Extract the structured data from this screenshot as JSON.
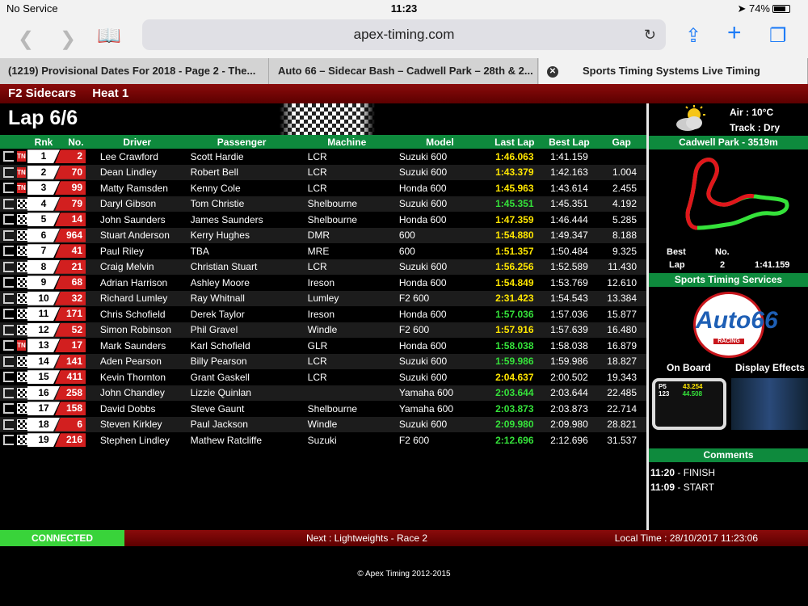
{
  "status": {
    "carrier": "No Service",
    "time": "11:23",
    "battery": "74%"
  },
  "browser": {
    "url": "apex-timing.com",
    "tabs": [
      "(1219) Provisional Dates For 2018 - Page 2 - The...",
      "Auto 66 – Sidecar Bash – Cadwell Park – 28th & 2...",
      "Sports Timing Systems Live Timing"
    ]
  },
  "event": {
    "class": "F2 Sidecars",
    "session": "Heat 1",
    "lap": "Lap 6/6"
  },
  "table": {
    "headers": [
      "Rnk",
      "No.",
      "Driver",
      "Passenger",
      "Machine",
      "Model",
      "Last Lap",
      "Best Lap",
      "Gap"
    ],
    "rows": [
      [
        "tn",
        "1",
        "2",
        "Lee Crawford",
        "Scott Hardie",
        "LCR",
        "Suzuki 600",
        "1:46.063",
        "y",
        "1:41.159",
        ""
      ],
      [
        "tn",
        "2",
        "70",
        "Dean Lindley",
        "Robert Bell",
        "LCR",
        "Suzuki 600",
        "1:43.379",
        "y",
        "1:42.163",
        "1.004"
      ],
      [
        "tn",
        "3",
        "99",
        "Matty Ramsden",
        "Kenny Cole",
        "LCR",
        "Honda 600",
        "1:45.963",
        "y",
        "1:43.614",
        "2.455"
      ],
      [
        "flag",
        "4",
        "79",
        "Daryl Gibson",
        "Tom Christie",
        "Shelbourne",
        "Suzuki 600",
        "1:45.351",
        "g",
        "1:45.351",
        "4.192"
      ],
      [
        "flag",
        "5",
        "14",
        "John Saunders",
        "James Saunders",
        "Shelbourne",
        "Honda 600",
        "1:47.359",
        "y",
        "1:46.444",
        "5.285"
      ],
      [
        "flag",
        "6",
        "964",
        "Stuart Anderson",
        "Kerry Hughes",
        "DMR",
        "600",
        "1:54.880",
        "y",
        "1:49.347",
        "8.188"
      ],
      [
        "flag",
        "7",
        "41",
        "Paul Riley",
        "TBA",
        "MRE",
        "600",
        "1:51.357",
        "y",
        "1:50.484",
        "9.325"
      ],
      [
        "flag",
        "8",
        "21",
        "Craig Melvin",
        "Christian Stuart",
        "LCR",
        "Suzuki 600",
        "1:56.256",
        "y",
        "1:52.589",
        "11.430"
      ],
      [
        "flag",
        "9",
        "68",
        "Adrian Harrison",
        "Ashley Moore",
        "Ireson",
        "Honda 600",
        "1:54.849",
        "y",
        "1:53.769",
        "12.610"
      ],
      [
        "flag",
        "10",
        "32",
        "Richard Lumley",
        "Ray Whitnall",
        "Lumley",
        "F2 600",
        "2:31.423",
        "y",
        "1:54.543",
        "13.384"
      ],
      [
        "flag",
        "11",
        "171",
        "Chris Schofield",
        "Derek Taylor",
        "Ireson",
        "Honda 600",
        "1:57.036",
        "g",
        "1:57.036",
        "15.877"
      ],
      [
        "flag",
        "12",
        "52",
        "Simon Robinson",
        "Phil Gravel",
        "Windle",
        "F2 600",
        "1:57.916",
        "y",
        "1:57.639",
        "16.480"
      ],
      [
        "tn",
        "13",
        "17",
        "Mark Saunders",
        "Karl Schofield",
        "GLR",
        "Honda 600",
        "1:58.038",
        "g",
        "1:58.038",
        "16.879"
      ],
      [
        "flag",
        "14",
        "141",
        "Aden Pearson",
        "Billy Pearson",
        "LCR",
        "Suzuki 600",
        "1:59.986",
        "g",
        "1:59.986",
        "18.827"
      ],
      [
        "flag",
        "15",
        "411",
        "Kevin Thornton",
        "Grant Gaskell",
        "LCR",
        "Suzuki 600",
        "2:04.637",
        "y",
        "2:00.502",
        "19.343"
      ],
      [
        "flag",
        "16",
        "258",
        "John Chandley",
        "Lizzie Quinlan",
        "",
        "Yamaha 600",
        "2:03.644",
        "g",
        "2:03.644",
        "22.485"
      ],
      [
        "flag",
        "17",
        "158",
        "David Dobbs",
        "Steve Gaunt",
        "Shelbourne",
        "Yamaha 600",
        "2:03.873",
        "g",
        "2:03.873",
        "22.714"
      ],
      [
        "flag",
        "18",
        "6",
        "Steven Kirkley",
        "Paul Jackson",
        "Windle",
        "Suzuki 600",
        "2:09.980",
        "g",
        "2:09.980",
        "28.821"
      ],
      [
        "flag",
        "19",
        "216",
        "Stephen Lindley",
        "Mathew Ratcliffe",
        "Suzuki",
        "F2 600",
        "2:12.696",
        "g",
        "2:12.696",
        "31.537"
      ]
    ]
  },
  "weather": {
    "air": "Air : 10°C",
    "track": "Track : Dry"
  },
  "circuit": {
    "name": "Cadwell Park - 3519m",
    "best_label": "Best",
    "no_label": "No.",
    "lap_label": "Lap",
    "best_no": "2",
    "best_time": "1:41.159"
  },
  "sponsor": {
    "title": "Sports Timing Services",
    "logo_text": "Auto66",
    "logo_sub": "RACING"
  },
  "onboard": {
    "left": "On Board",
    "right": "Display Effects",
    "pos": "P5",
    "time": "43.254",
    "lapno": "123",
    "delta": "44.508"
  },
  "comments": {
    "title": "Comments",
    "items": [
      {
        "t": "11:20",
        "m": " - FINISH"
      },
      {
        "t": "11:09",
        "m": " - START"
      }
    ]
  },
  "footer": {
    "connected": "CONNECTED",
    "next": "Next : Lightweights - Race 2",
    "local": "Local Time : 28/10/2017 11:23:06",
    "copyright": "© Apex Timing 2012-2015"
  }
}
